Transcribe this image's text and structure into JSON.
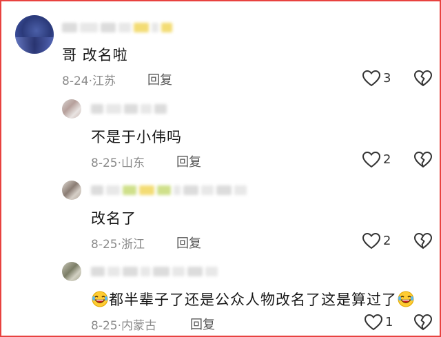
{
  "comments": [
    {
      "text": "哥  改名啦",
      "date": "8-24",
      "location": "江苏",
      "reply_label": "回复",
      "likes": "3"
    },
    {
      "text": "不是于小伟吗",
      "date": "8-25",
      "location": "山东",
      "reply_label": "回复",
      "likes": "2"
    },
    {
      "text": "改名了",
      "date": "8-25",
      "location": "浙江",
      "reply_label": "回复",
      "likes": "2"
    },
    {
      "text": "都半辈子了还是公众人物改名了这是算过了",
      "date": "8-25",
      "location": "内蒙古",
      "reply_label": "回复",
      "likes": "1",
      "emoji": "laughing-crying-emoji"
    }
  ],
  "separator": "·",
  "colors": {
    "border": "#e8423f",
    "text": "#161616",
    "meta": "#8a8a8a"
  },
  "icons": {
    "like": "heart-outline-icon",
    "dislike": "broken-heart-icon"
  }
}
